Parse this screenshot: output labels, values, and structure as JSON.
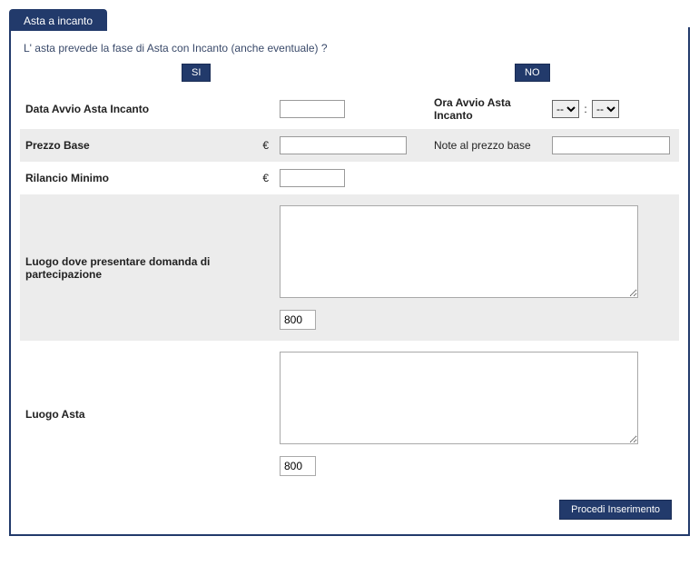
{
  "tab_title": "Asta a incanto",
  "question": "L' asta prevede la fase di Asta con Incanto (anche eventuale) ?",
  "buttons": {
    "si": "SI",
    "no": "NO",
    "procedi": "Procedi Inserimento"
  },
  "labels": {
    "data_avvio": "Data Avvio Asta Incanto",
    "ora_avvio": "Ora Avvio Asta Incanto",
    "prezzo_base": "Prezzo Base",
    "note_prezzo": "Note al prezzo base",
    "rilancio_minimo": "Rilancio Minimo",
    "luogo_domanda": "Luogo dove presentare domanda di partecipazione",
    "luogo_asta": "Luogo Asta"
  },
  "currency": "€",
  "time": {
    "placeholder": "--",
    "separator": ":"
  },
  "values": {
    "data_avvio": "",
    "ora_h": "--",
    "ora_m": "--",
    "prezzo_base": "",
    "note_prezzo": "",
    "rilancio_minimo": "",
    "luogo_domanda": "",
    "luogo_domanda_count": "800",
    "luogo_asta": "",
    "luogo_asta_count": "800"
  }
}
